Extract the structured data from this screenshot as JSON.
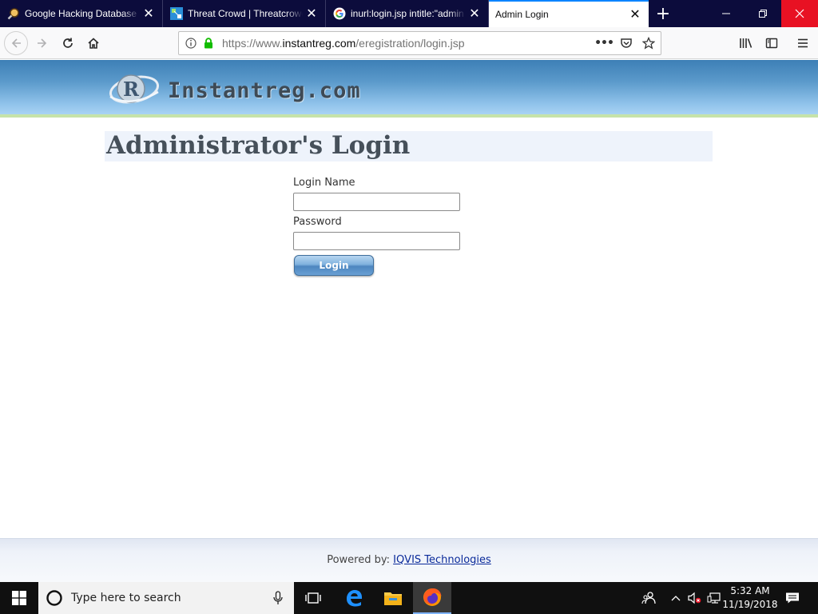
{
  "browser": {
    "tabs": [
      {
        "title": "Google Hacking Database (",
        "favicon": "magnifier-favicon",
        "active": false
      },
      {
        "title": "Threat Crowd | Threatcrowd",
        "favicon": "threatcrowd-favicon",
        "active": false
      },
      {
        "title": "inurl:login.jsp intitle:\"admin",
        "favicon": "google-favicon",
        "active": false
      },
      {
        "title": "Admin Login",
        "favicon": "",
        "active": true
      }
    ],
    "url": {
      "scheme": "https://www.",
      "host": "instantreg.com",
      "path": "/eregistration/login.jsp"
    }
  },
  "page": {
    "logo_text": "Instantreg.com",
    "logo_letter": "R",
    "title": "Administrator's Login",
    "form": {
      "login_name_label": "Login Name",
      "password_label": "Password",
      "login_button": "Login"
    },
    "footer": {
      "prefix": "Powered by: ",
      "link_text": "IQVIS Technologies"
    }
  },
  "taskbar": {
    "search_placeholder": "Type here to search",
    "time": "5:32 AM",
    "date": "11/19/2018"
  },
  "colors": {
    "tabstrip": "#0c0c3c",
    "accent_tab": "#0a84ff",
    "header_blue": "#5b9acb",
    "header_green_line": "#c6e3a9",
    "title_box": "#eef3fb",
    "close_red": "#e81123"
  }
}
